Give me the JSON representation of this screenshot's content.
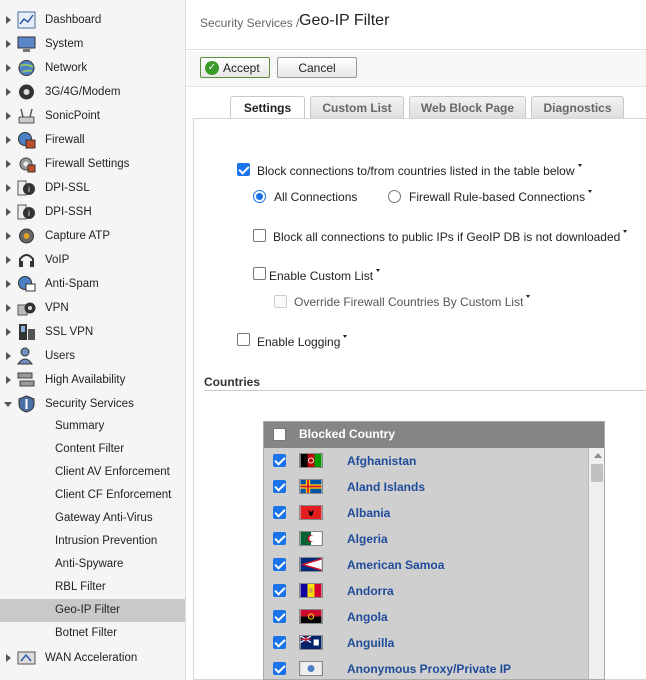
{
  "sidebar": {
    "items": [
      {
        "label": "Dashboard",
        "icon": "dashboard-icon"
      },
      {
        "label": "System",
        "icon": "monitor-icon"
      },
      {
        "label": "Network",
        "icon": "globe-icon"
      },
      {
        "label": "3G/4G/Modem",
        "icon": "modem-icon"
      },
      {
        "label": "SonicPoint",
        "icon": "access-point-icon"
      },
      {
        "label": "Firewall",
        "icon": "firewall-icon"
      },
      {
        "label": "Firewall Settings",
        "icon": "firewall-settings-icon"
      },
      {
        "label": "DPI-SSL",
        "icon": "dpi-ssl-icon"
      },
      {
        "label": "DPI-SSH",
        "icon": "dpi-ssh-icon"
      },
      {
        "label": "Capture ATP",
        "icon": "capture-atp-icon"
      },
      {
        "label": "VoIP",
        "icon": "headset-icon"
      },
      {
        "label": "Anti-Spam",
        "icon": "anti-spam-icon"
      },
      {
        "label": "VPN",
        "icon": "vpn-icon"
      },
      {
        "label": "SSL VPN",
        "icon": "ssl-vpn-icon"
      },
      {
        "label": "Users",
        "icon": "users-icon"
      },
      {
        "label": "High Availability",
        "icon": "high-availability-icon"
      },
      {
        "label": "Security Services",
        "icon": "shield-icon"
      }
    ],
    "security_services_sub": [
      "Summary",
      "Content Filter",
      "Client AV Enforcement",
      "Client CF Enforcement",
      "Gateway Anti-Virus",
      "Intrusion Prevention",
      "Anti-Spyware",
      "RBL Filter",
      "Geo-IP Filter",
      "Botnet Filter"
    ],
    "active_sub": "Geo-IP Filter",
    "after_items": [
      {
        "label": "WAN Acceleration",
        "icon": "wan-acceleration-icon"
      }
    ]
  },
  "header": {
    "breadcrumb_parent": "Security Services /",
    "title": "Geo-IP Filter"
  },
  "toolbar": {
    "accept_label": "Accept",
    "cancel_label": "Cancel"
  },
  "tabs": [
    {
      "label": "Settings",
      "active": true
    },
    {
      "label": "Custom List",
      "active": false
    },
    {
      "label": "Web Block Page",
      "active": false
    },
    {
      "label": "Diagnostics",
      "active": false
    }
  ],
  "settings": {
    "block_connections_label": "Block connections to/from countries listed in the table below",
    "block_connections_checked": true,
    "all_connections_label": "All Connections",
    "firewall_rule_label": "Firewall Rule-based Connections",
    "selected_mode": "All Connections",
    "block_public_ips_label": "Block all connections to public IPs if GeoIP DB is not downloaded",
    "block_public_ips_checked": false,
    "enable_custom_list_label": "Enable Custom List",
    "enable_custom_list_checked": false,
    "override_label": "Override Firewall Countries By Custom List",
    "override_checked": false,
    "enable_logging_label": "Enable Logging",
    "enable_logging_checked": false
  },
  "countries": {
    "heading": "Countries",
    "col_blocked": "Blocked",
    "col_country": "Country",
    "rows": [
      {
        "name": "Afghanistan",
        "blocked": true
      },
      {
        "name": "Aland Islands",
        "blocked": true
      },
      {
        "name": "Albania",
        "blocked": true
      },
      {
        "name": "Algeria",
        "blocked": true
      },
      {
        "name": "American Samoa",
        "blocked": true
      },
      {
        "name": "Andorra",
        "blocked": true
      },
      {
        "name": "Angola",
        "blocked": true
      },
      {
        "name": "Anguilla",
        "blocked": true
      },
      {
        "name": "Anonymous Proxy/Private IP",
        "blocked": true
      }
    ]
  },
  "colors": {
    "accent": "#1a73e8",
    "link": "#1f4b9a",
    "active_nav": "#c9c9c9",
    "table_header": "#858585",
    "table_body": "#cfcfcf"
  }
}
